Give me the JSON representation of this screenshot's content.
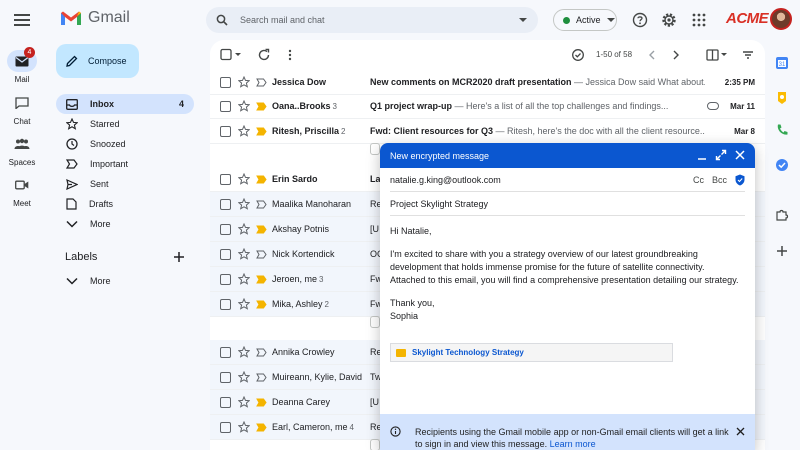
{
  "app": {
    "name": "Gmail",
    "brand": "ACME"
  },
  "search": {
    "placeholder": "Search mail and chat"
  },
  "status": {
    "label": "Active",
    "color": "#1e8e3e"
  },
  "rail": [
    {
      "label": "Mail",
      "icon": "mail-icon",
      "badge": "4",
      "active": true
    },
    {
      "label": "Chat",
      "icon": "chat-icon"
    },
    {
      "label": "Spaces",
      "icon": "spaces-icon"
    },
    {
      "label": "Meet",
      "icon": "meet-icon"
    }
  ],
  "compose_button": {
    "label": "Compose"
  },
  "nav": {
    "items": [
      {
        "label": "Inbox",
        "icon": "inbox-icon",
        "count": "4",
        "active": true
      },
      {
        "label": "Starred",
        "icon": "star-icon"
      },
      {
        "label": "Snoozed",
        "icon": "clock-icon"
      },
      {
        "label": "Important",
        "icon": "important-icon"
      },
      {
        "label": "Sent",
        "icon": "send-icon"
      },
      {
        "label": "Drafts",
        "icon": "draft-icon"
      },
      {
        "label": "More",
        "icon": "chevron-down-icon"
      }
    ],
    "labels_heading": "Labels",
    "labels_more": "More"
  },
  "toolbar": {
    "pager": "1-50 of 58"
  },
  "emails": [
    {
      "sender": "Jessica Dow",
      "count": "",
      "subject": "New comments on MCR2020 draft presentation",
      "snippet": " — Jessica Dow said What about...",
      "date": "2:35 PM",
      "unread": true,
      "important": false
    },
    {
      "sender": "Oana..Brooks",
      "count": "3",
      "subject": "Q1 project wrap-up",
      "snippet": " — Here's a list of all the top challenges and findings...",
      "date": "Mar 11",
      "unread": true,
      "important": true,
      "attachment": true
    },
    {
      "sender": "Ritesh, Priscilla",
      "count": "2",
      "subject": "Fwd: Client resources for Q3",
      "snippet": " — Ritesh, here's the doc with all the client resource...",
      "date": "Mar 8",
      "unread": true,
      "important": true
    },
    {
      "sender": "Erin Sardo",
      "count": "",
      "subject": "La",
      "snippet": "",
      "date": "",
      "unread": true,
      "important": true
    },
    {
      "sender": "Maalika Manoharan",
      "count": "",
      "subject": "Re",
      "snippet": "",
      "date": "",
      "unread": false,
      "important": false
    },
    {
      "sender": "Akshay Potnis",
      "count": "",
      "subject": "[U",
      "snippet": "",
      "date": "",
      "unread": false,
      "important": true
    },
    {
      "sender": "Nick Kortendick",
      "count": "",
      "subject": "OC",
      "snippet": "",
      "date": "",
      "unread": false,
      "important": false
    },
    {
      "sender": "Jeroen, me",
      "count": "3",
      "subject": "Fw",
      "snippet": "",
      "date": "",
      "unread": false,
      "important": true
    },
    {
      "sender": "Mika, Ashley",
      "count": "2",
      "subject": "Fw",
      "snippet": "",
      "date": "",
      "unread": false,
      "important": true
    },
    {
      "sender": "Annika Crowley",
      "count": "",
      "subject": "Re",
      "snippet": "",
      "date": "",
      "unread": false,
      "important": false
    },
    {
      "sender": "Muireann, Kylie, David",
      "count": "",
      "subject": "Tw",
      "snippet": "",
      "date": "",
      "unread": false,
      "important": false
    },
    {
      "sender": "Deanna Carey",
      "count": "",
      "subject": "[U",
      "snippet": "",
      "date": "",
      "unread": false,
      "important": true
    },
    {
      "sender": "Earl, Cameron, me",
      "count": "4",
      "subject": "Re",
      "snippet": "",
      "date": "",
      "unread": false,
      "important": true
    }
  ],
  "compose_window": {
    "title": "New encrypted message",
    "to": "natalie.g.king@outlook.com",
    "cc": "Cc",
    "bcc": "Bcc",
    "subject": "Project Skylight Strategy",
    "greeting": "Hi Natalie,",
    "body": "I'm excited to share with you a strategy overview of our latest groundbreaking development that holds immense promise for the future of satellite connectivity. Attached to this email, you will find a comprehensive presentation detailing our strategy.",
    "signoff": "Thank you,",
    "signature": "Sophia",
    "attachment": "Skylight Technology Strategy",
    "notice": "Recipients using the Gmail mobile app or non-Gmail email clients will get a link to sign in and view this message.",
    "notice_link": "Learn more"
  },
  "colors": {
    "accent": "#0b57d0",
    "important": "#f4b400",
    "brand": "#d93025"
  }
}
